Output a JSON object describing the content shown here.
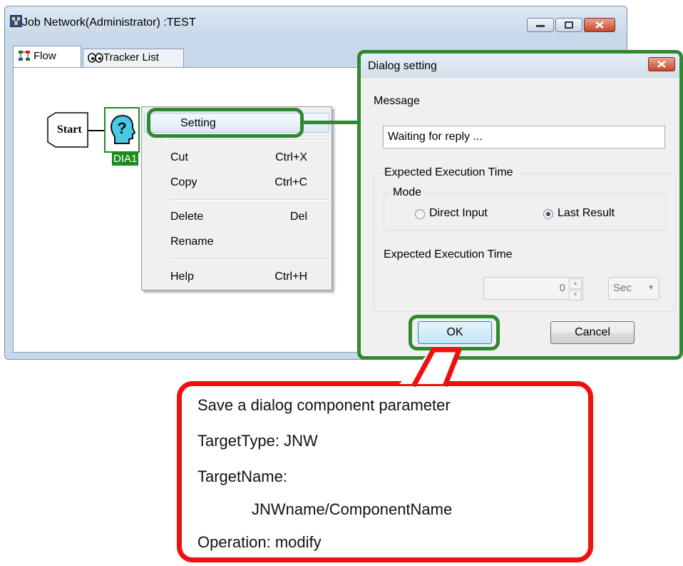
{
  "window": {
    "title": "Job Network(Administrator) :TEST",
    "tabs": [
      {
        "label": "Flow",
        "icon": "flow-icon"
      },
      {
        "label": "Tracker List",
        "icon": "tracker-eyes-icon"
      }
    ]
  },
  "flow": {
    "start_label": "Start",
    "dialog_component": {
      "label": "DIA1",
      "icon": "question-head-icon"
    }
  },
  "context_menu": {
    "items": [
      {
        "label": "Setting",
        "shortcut": ""
      },
      {
        "label": "Cut",
        "shortcut": "Ctrl+X"
      },
      {
        "label": "Copy",
        "shortcut": "Ctrl+C"
      },
      {
        "label": "Delete",
        "shortcut": "Del"
      },
      {
        "label": "Rename",
        "shortcut": ""
      },
      {
        "label": "Help",
        "shortcut": "Ctrl+H"
      }
    ]
  },
  "dialog": {
    "title": "Dialog setting",
    "message_label": "Message",
    "message_value": "Waiting for reply ...",
    "group_title": "Expected Execution Time",
    "mode_title": "Mode",
    "mode_options": [
      {
        "label": "Direct Input",
        "selected": false
      },
      {
        "label": "Last Result",
        "selected": true
      }
    ],
    "time_label": "Expected Execution Time",
    "time_value": "0",
    "unit_value": "Sec",
    "ok_label": "OK",
    "cancel_label": "Cancel"
  },
  "callout": {
    "lines": [
      "Save a dialog component parameter",
      "TargetType: JNW",
      "TargetName:",
      "JNWname/ComponentName",
      "Operation: modify"
    ]
  },
  "colors": {
    "highlight_green": "#2f8a2f",
    "callout_red": "#ee1111",
    "component_green": "#1b8b1b"
  }
}
